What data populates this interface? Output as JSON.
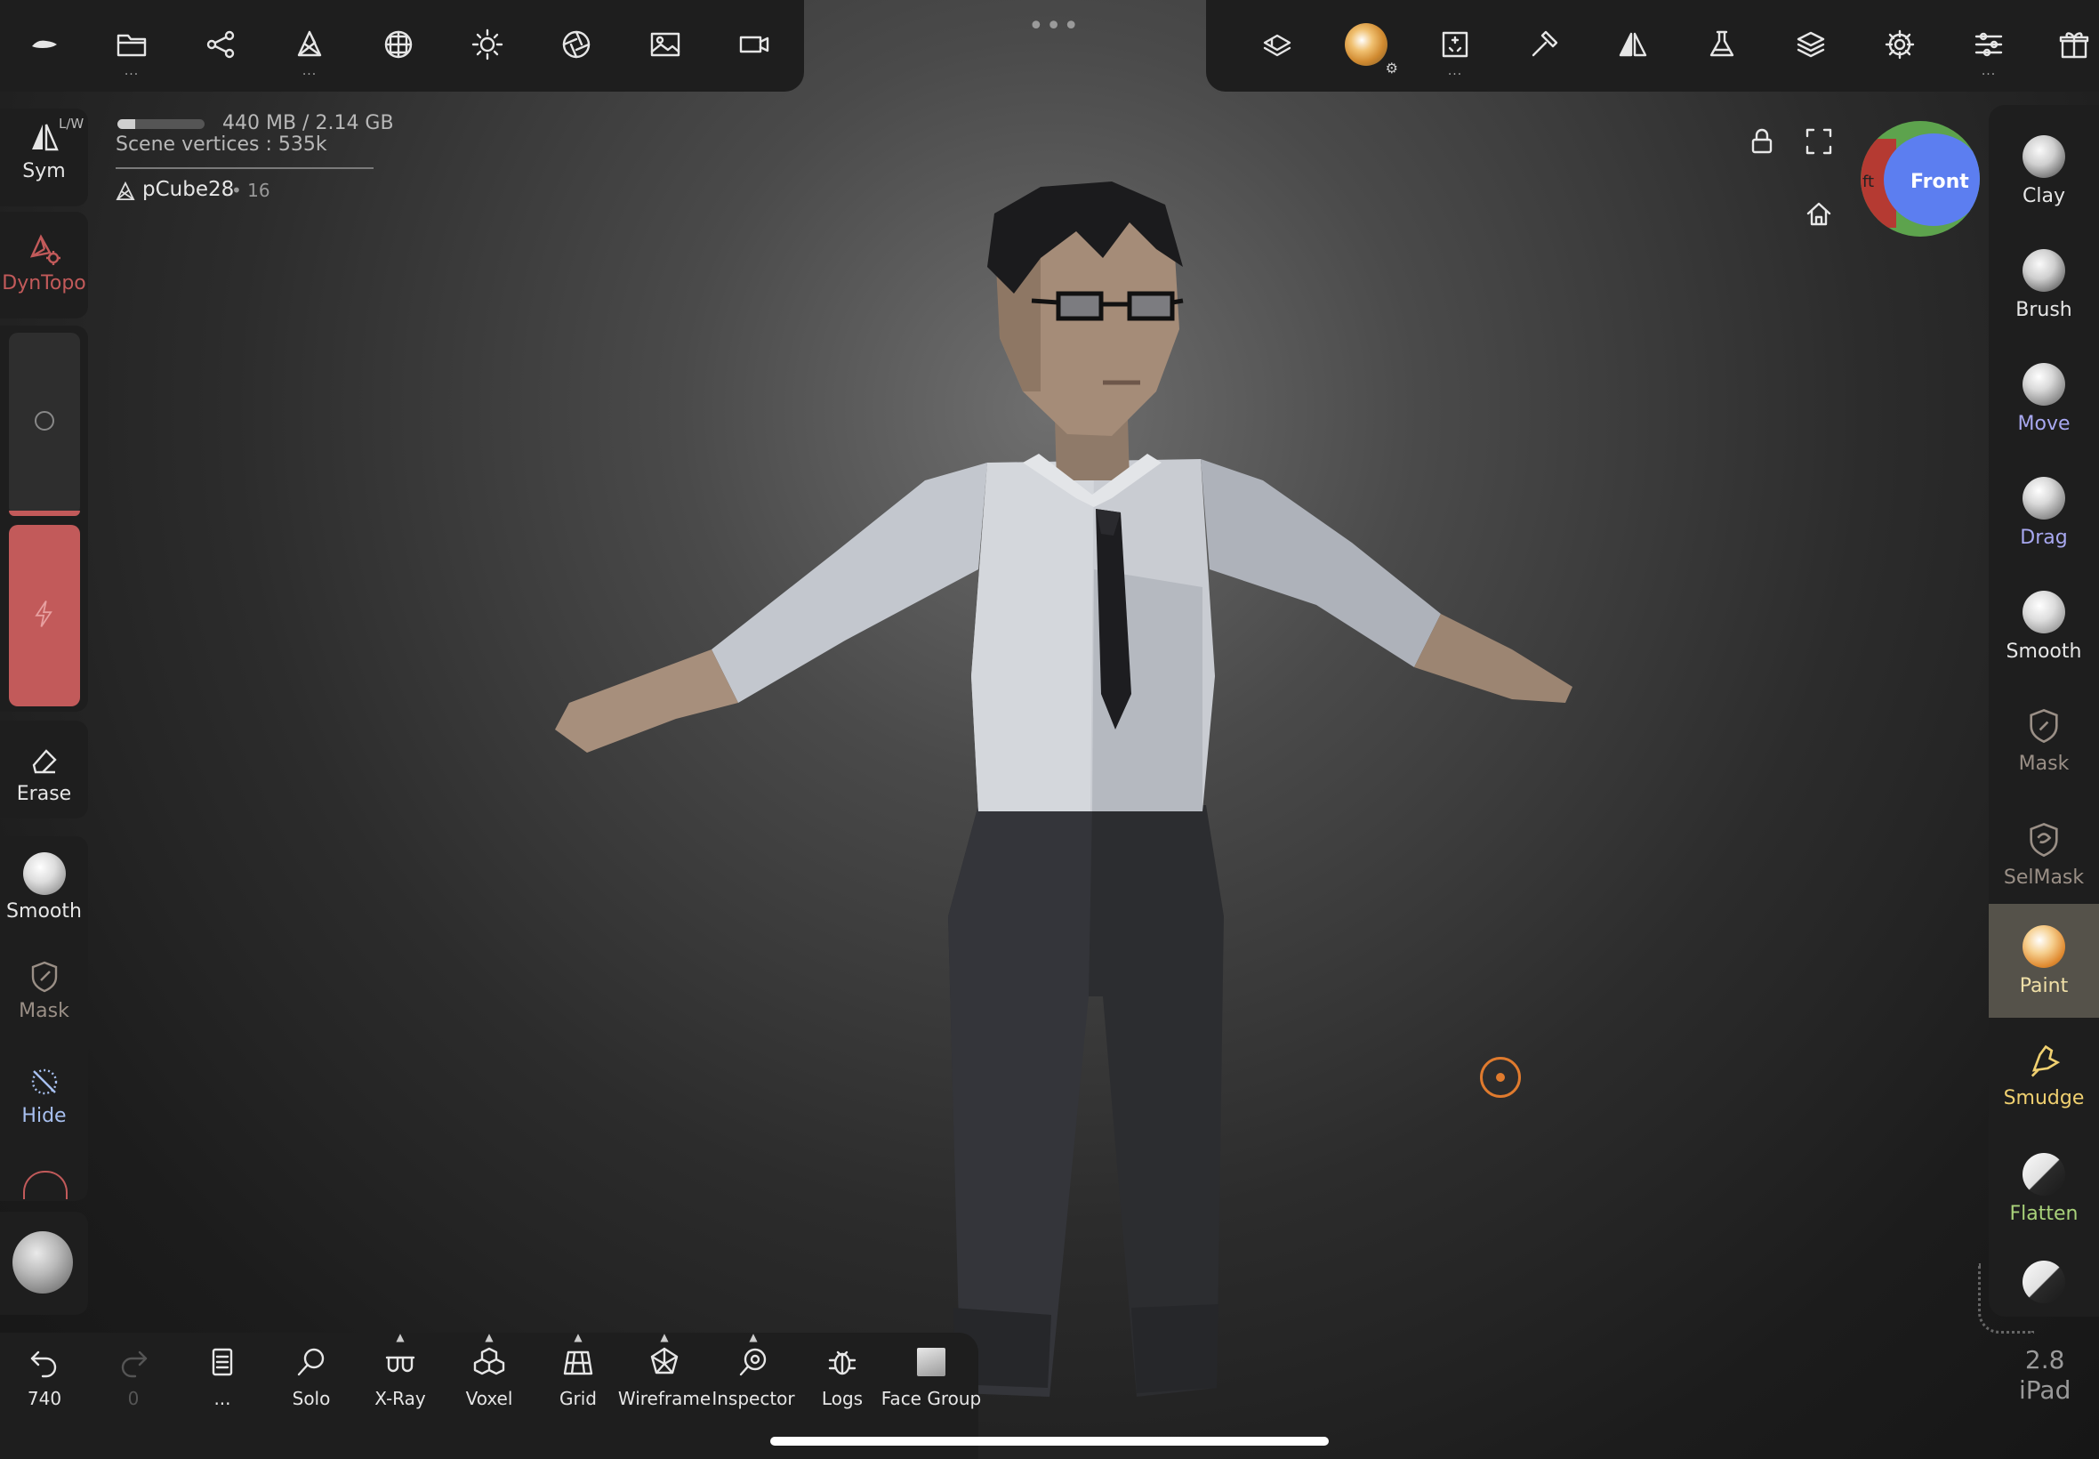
{
  "top_left_toolbar": {
    "icons": [
      "logo-icon",
      "folder-icon",
      "share-icon",
      "mesh-icon",
      "sphere-grid-icon",
      "sun-icon",
      "aperture-icon",
      "image-icon",
      "camera-icon"
    ]
  },
  "top_right_toolbar": {
    "icons": [
      "layers-3d-icon",
      "paint-sphere-icon",
      "transform-icon",
      "hammer-icon",
      "mirror-icon",
      "flask-icon",
      "layers-icon",
      "gear-icon",
      "sliders-icon",
      "gift-icon"
    ]
  },
  "left_toolbar": {
    "sym_label": "Sym",
    "sym_badge": "L/W",
    "dyntopo_label": "DynTopo",
    "erase_label": "Erase",
    "smooth_label": "Smooth",
    "mask_label": "Mask",
    "hide_label": "Hide"
  },
  "info": {
    "memory": "440 MB / 2.14 GB",
    "memory_fraction": 0.2,
    "scene_vertices": "Scene vertices : 535k",
    "object_name": "pCube28",
    "object_count": "• 16"
  },
  "view_gizmo": {
    "front_label": "Front",
    "side_label": "ft"
  },
  "right_toolbar": {
    "tools": [
      {
        "label": "Clay",
        "color": "#e6e6e6"
      },
      {
        "label": "Brush",
        "color": "#e6e6e6"
      },
      {
        "label": "Move",
        "color": "#a8a8f0"
      },
      {
        "label": "Drag",
        "color": "#a8a8f0"
      },
      {
        "label": "Smooth",
        "color": "#e6e6e6"
      },
      {
        "label": "Mask",
        "color": "#9a8f86"
      },
      {
        "label": "SelMask",
        "color": "#9a8f86"
      },
      {
        "label": "Paint",
        "color": "#f0e0a8"
      },
      {
        "label": "Smudge",
        "color": "#f0d070"
      },
      {
        "label": "Flatten",
        "color": "#a9d27a"
      }
    ],
    "active_tool": "Paint"
  },
  "bottom_bar": {
    "undo_count": "740",
    "redo_count": "0",
    "menu_label": "...",
    "items": [
      "Solo",
      "X-Ray",
      "Voxel",
      "Grid",
      "Wireframe",
      "Inspector",
      "Logs",
      "Face Group"
    ]
  },
  "version": {
    "number": "2.8",
    "device": "iPad"
  },
  "colors": {
    "accent_red": "#c25a5a",
    "cursor_orange": "#e07b2e",
    "panel": "#1e1e1e"
  }
}
